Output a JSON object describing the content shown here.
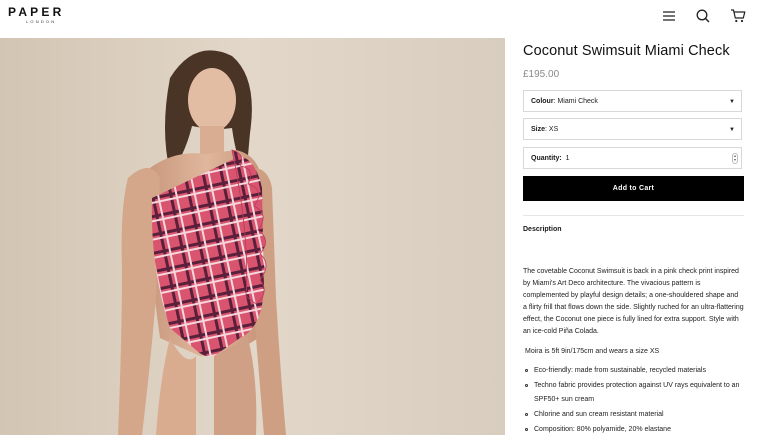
{
  "header": {
    "logo_main": "PAPER",
    "logo_sub": "LONDON",
    "menu_icon": "hamburger-menu-icon",
    "search_icon": "search-icon",
    "cart_icon": "cart-icon"
  },
  "product": {
    "title": "Coconut Swimsuit Miami Check",
    "price": "£195.00",
    "colour_label": "Colour",
    "colour_value": "Miami Check",
    "size_label": "Size",
    "size_value": "XS",
    "quantity_label": "Quantity:",
    "quantity_value": "1",
    "add_to_cart": "Add to Cart"
  },
  "description": {
    "heading": "Description",
    "body": "The covetable Coconut Swimsuit is back in a pink check print inspired by Miami's Art Deco architecture. The vivacious pattern is complemented by playful design details; a one-shouldered shape and a flirty frill that flows down the side. Slightly ruched for an ultra-flattering effect, the Coconut one piece is fully lined for extra support. Style with an ice-cold Piña Colada.",
    "model_note": "Moira is 5ft 9in/175cm and wears a size XS",
    "bullets": [
      "Eco-friendly: made from sustainable, recycled materials",
      "Techno fabric provides protection against UV rays equivalent to an SPF50+ sun cream",
      "Chlorine and sun cream resistant material",
      "Composition: 80% polyamide, 20% elastane"
    ]
  },
  "colors": {
    "button_bg": "#000000",
    "price_grey": "#8a8a8a",
    "swimsuit_pink": "#d9546f",
    "photo_bg": "#ddd2c4"
  }
}
